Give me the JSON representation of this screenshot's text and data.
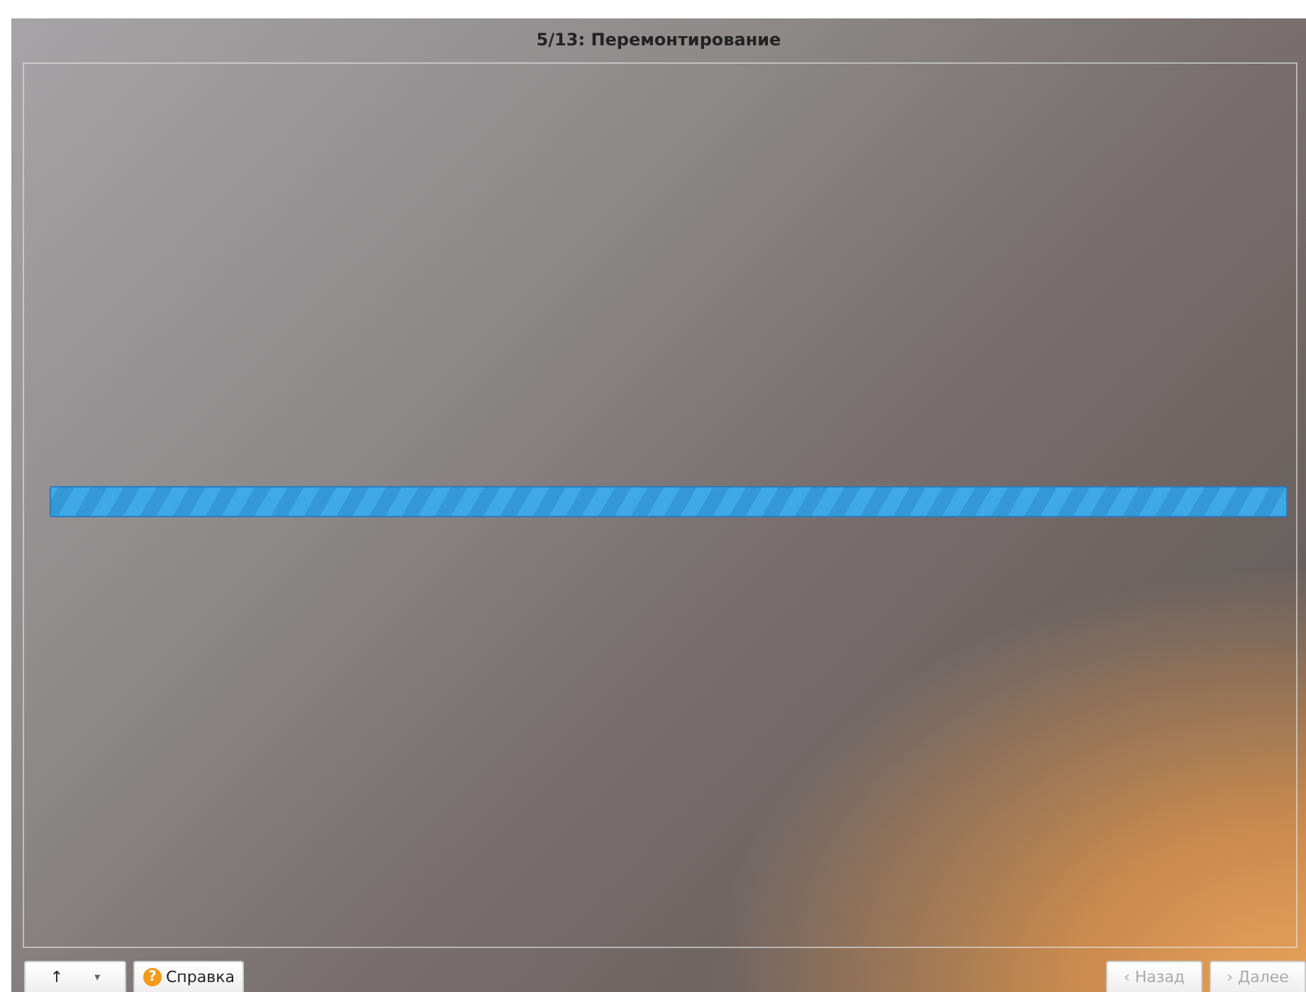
{
  "window": {
    "title": "5/13: Перемонтирование"
  },
  "progress": {
    "level": 1
  },
  "buttons": [
    {
      "kind": "up",
      "label": "↑",
      "dropdown": "▾",
      "disabled": false
    },
    {
      "kind": "help",
      "label": "Справка",
      "icon": "?",
      "disabled": false
    },
    {
      "kind": "back",
      "label": "Назад",
      "icon": "‹",
      "disabled": true
    },
    {
      "kind": "next",
      "label": "Далее",
      "icon": "›",
      "disabled": true
    }
  ]
}
